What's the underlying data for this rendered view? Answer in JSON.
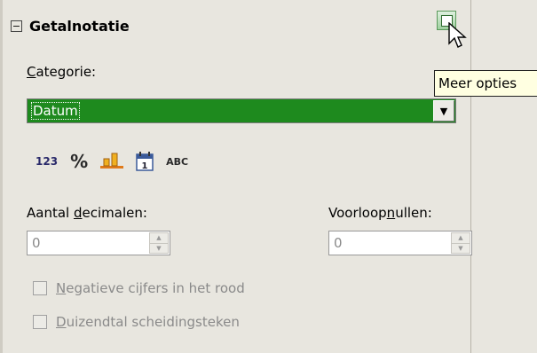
{
  "section": {
    "title": "Getalnotatie",
    "collapse_symbol": "−"
  },
  "more_options": {
    "icon": "more-options-icon",
    "tooltip": "Meer opties"
  },
  "category": {
    "label_prefix": "C",
    "label_rest": "ategorie:",
    "selected": "Datum",
    "highlight_color": "#1e8a1e"
  },
  "format_icons": [
    {
      "name": "number-icon",
      "text": "123"
    },
    {
      "name": "percent-icon",
      "text": "%"
    },
    {
      "name": "currency-icon",
      "text": ""
    },
    {
      "name": "calendar-icon",
      "text": "1"
    },
    {
      "name": "text-icon",
      "text": "ABC"
    }
  ],
  "decimals": {
    "label_a": "Aantal ",
    "label_u": "d",
    "label_b": "ecimalen:",
    "value": "0"
  },
  "leading_zeros": {
    "label_a": "Voorloop",
    "label_u": "n",
    "label_b": "ullen:",
    "value": "0"
  },
  "checkboxes": [
    {
      "u": "N",
      "rest": "egatieve cijfers in het rood",
      "checked": false
    },
    {
      "u": "D",
      "rest": "uizendtal scheidingsteken",
      "checked": false
    }
  ]
}
